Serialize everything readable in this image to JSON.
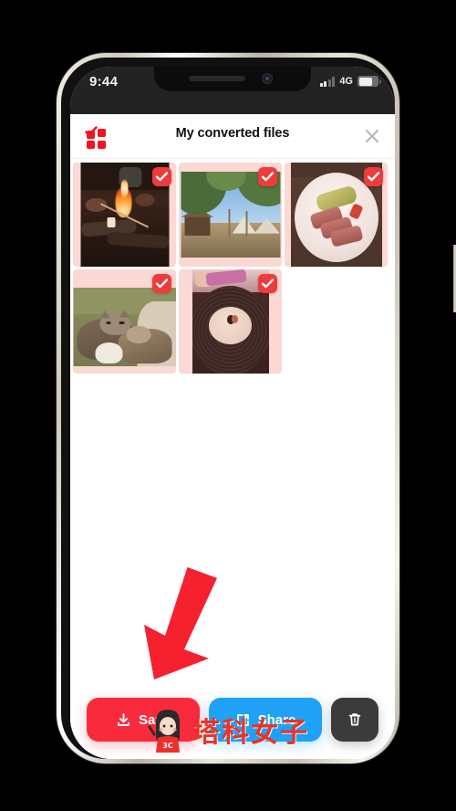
{
  "device": {
    "statusbar": {
      "time": "9:44",
      "network_label": "4G",
      "signal_icon": "cellular-signal-icon",
      "battery_icon": "battery-icon"
    }
  },
  "app": {
    "logo_icon": "app-logo-grid-check-icon",
    "title": "My converted files",
    "close_icon": "close-x-icon"
  },
  "gallery": {
    "items": [
      {
        "id": 1,
        "alt": "campfire-with-marshmallow",
        "selected": true,
        "check_icon": "check-badge-icon"
      },
      {
        "id": 2,
        "alt": "campsite-tents-under-trees",
        "selected": true,
        "check_icon": "check-badge-icon"
      },
      {
        "id": 3,
        "alt": "sliced-steak-on-white-plate",
        "selected": true,
        "check_icon": "check-badge-icon"
      },
      {
        "id": 4,
        "alt": "two-cats-cuddling",
        "selected": true,
        "check_icon": "check-badge-icon"
      },
      {
        "id": 5,
        "alt": "vinyl-record-close-up",
        "selected": true,
        "check_icon": "check-badge-icon"
      }
    ]
  },
  "annotation": {
    "arrow_icon": "red-down-left-arrow-icon",
    "arrow_color": "#f5212f",
    "points_to": "save-button"
  },
  "actions": {
    "save": {
      "label": "Save",
      "icon": "download-icon",
      "color": "#fa2a3d"
    },
    "share": {
      "label": "Share",
      "icon": "share-external-icon",
      "color": "#1fa2f5"
    },
    "delete": {
      "label": "",
      "icon": "trash-icon",
      "color": "#3b3b3b"
    }
  },
  "watermark": {
    "text": "塔科女子",
    "avatar_icon": "mascot-avatar-icon",
    "badge_text": "3C",
    "color": "#ef3125"
  }
}
